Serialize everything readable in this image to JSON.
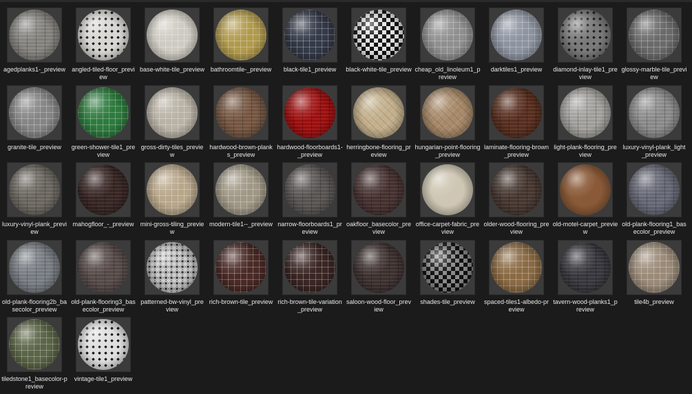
{
  "files": [
    {
      "name": "agedplanks1-_preview",
      "base": "#8a8782",
      "pattern": "planks"
    },
    {
      "name": "angled-tiled-floor_preview",
      "base": "#d8d6d2",
      "pattern": "diamonds"
    },
    {
      "name": "base-white-tile_preview",
      "base": "#cfcbc2",
      "pattern": "grid"
    },
    {
      "name": "bathroomtile-_preview",
      "base": "#b19a4d",
      "pattern": "grid"
    },
    {
      "name": "black-tile1_preview",
      "base": "#343a48",
      "pattern": "grid"
    },
    {
      "name": "black-white-tile_preview",
      "base": "#e6e6e6",
      "pattern": "checker"
    },
    {
      "name": "cheap_old_linoleum1_preview",
      "base": "#8f8f8f",
      "pattern": "grid"
    },
    {
      "name": "darktiles1_preview",
      "base": "#8d93a0",
      "pattern": "grid"
    },
    {
      "name": "diamond-inlay-tile1_preview",
      "base": "#7a7a7a",
      "pattern": "diamonds"
    },
    {
      "name": "glossy-marble-tile_preview",
      "base": "#6a6a6a",
      "pattern": "grid"
    },
    {
      "name": "granite-tile_preview",
      "base": "#858585",
      "pattern": "grid"
    },
    {
      "name": "green-shower-tile1_preview",
      "base": "#2e7a3e",
      "pattern": "grid"
    },
    {
      "name": "gross-dirty-tiles_preview",
      "base": "#b9b2a5",
      "pattern": "grid"
    },
    {
      "name": "hardwood-brown-planks_preview",
      "base": "#7a5a45",
      "pattern": "planks"
    },
    {
      "name": "hardwood-floorboards1-_preview",
      "base": "#a31010",
      "pattern": "planks"
    },
    {
      "name": "herringbone-flooring_preview",
      "base": "#c4b08c",
      "pattern": "herring"
    },
    {
      "name": "hungarian-point-flooring_preview",
      "base": "#a88a6a",
      "pattern": "herring"
    },
    {
      "name": "laminate-flooring-brown_preview",
      "base": "#5c3020",
      "pattern": "planks"
    },
    {
      "name": "light-plank-flooring_preview",
      "base": "#a8a6a2",
      "pattern": "planks"
    },
    {
      "name": "luxury-vinyl-plank_light_preview",
      "base": "#909090",
      "pattern": "planks"
    },
    {
      "name": "luxury-vinyl-plank_preview",
      "base": "#706c64",
      "pattern": "planks"
    },
    {
      "name": "mahogfloor_-_preview",
      "base": "#3a2826",
      "pattern": "planks"
    },
    {
      "name": "mini-gross-tiling_preview",
      "base": "#b8a68a",
      "pattern": "grid"
    },
    {
      "name": "modern-tile1--_preview",
      "base": "#a09886",
      "pattern": "grid"
    },
    {
      "name": "narrow-floorboards1_preview",
      "base": "#5c5856",
      "pattern": "planks"
    },
    {
      "name": "oakfloor_basecolor_preview",
      "base": "#4a3434",
      "pattern": "planks"
    },
    {
      "name": "office-carpet-fabric_preview",
      "base": "#cfc7b4",
      "pattern": "none"
    },
    {
      "name": "older-wood-flooring_preview",
      "base": "#4a3a32",
      "pattern": "planks"
    },
    {
      "name": "old-motel-carpet_preview",
      "base": "#8a5a38",
      "pattern": "none"
    },
    {
      "name": "old-plank-flooring1_basecolor_preview",
      "base": "#6a6c7a",
      "pattern": "planks"
    },
    {
      "name": "old-plank-flooring2b_basecolor_preview",
      "base": "#7d8288",
      "pattern": "planks"
    },
    {
      "name": "old-plank-flooring3_basecolor_preview",
      "base": "#5a4e4c",
      "pattern": "planks"
    },
    {
      "name": "patterned-bw-vinyl_preview",
      "base": "#cfcfcf",
      "pattern": "dots"
    },
    {
      "name": "rich-brown-tile_preview",
      "base": "#4a2a26",
      "pattern": "grid"
    },
    {
      "name": "rich-brown-tile-variation_preview",
      "base": "#3a2624",
      "pattern": "grid"
    },
    {
      "name": "saloon-wood-floor_preview",
      "base": "#403432",
      "pattern": "planks"
    },
    {
      "name": "shades-tile_preview",
      "base": "#8a8a8a",
      "pattern": "checker"
    },
    {
      "name": "spaced-tiles1-albedo-preview",
      "base": "#8a6a44",
      "pattern": "grid"
    },
    {
      "name": "tavern-wood-planks1_preview",
      "base": "#3a3a40",
      "pattern": "planks"
    },
    {
      "name": "tile4b_preview",
      "base": "#9a8a78",
      "pattern": "grid"
    },
    {
      "name": "tiledstone1_basecolor-preview",
      "base": "#5a6446",
      "pattern": "grid"
    },
    {
      "name": "vintage-tile1_preview",
      "base": "#dedede",
      "pattern": "diamonds"
    }
  ]
}
